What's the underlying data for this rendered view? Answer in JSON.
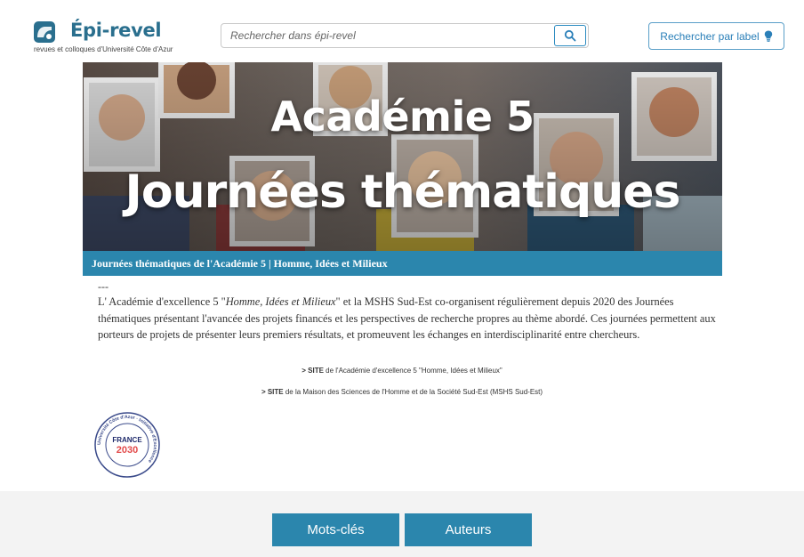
{
  "header": {
    "brand": "Épi-revel",
    "tagline": "revues et colloques d'Université Côte d'Azur",
    "search_placeholder": "Rechercher dans épi-revel",
    "search_icon": "search-icon",
    "label_button": "Rechercher par label",
    "label_icon": "lightbulb-icon",
    "accent_color": "#2a6f8e"
  },
  "banner": {
    "title_line1": "Académie 5",
    "title_line2": "Journées thématiques",
    "caption": "Journées thématiques de l'Académie 5 | Homme, Idées et Milieux",
    "caption_color": "#2b86ad"
  },
  "content": {
    "dashes": "---",
    "intro_before": "L' Académie d'excellence 5 \"",
    "intro_em": "Homme, Idées et Milieux",
    "intro_after": "\" et la MSHS Sud-Est co-organisent régulièrement depuis 2020 des Journées thématiques présentant l'avancée des projets financés et les perspectives de recherche propres au thème abordé. Ces journées permettent aux porteurs de projets de présenter leurs premiers résultats, et promeuvent les échanges en interdisciplinarité entre chercheurs.",
    "link1_prefix": "> SITE",
    "link1_text": " de l'Académie d'excellence 5 \"Homme, Idées et Milieux\"",
    "link2_prefix": "> SITE",
    "link2_text": " de la Maison des Sciences de l'Homme et de la Société Sud-Est (MSHS Sud-Est)"
  },
  "seal": {
    "ring_text": "Université Côte d'Azur · Initiative d'Excellence",
    "center_top": "FRANCE",
    "center_bottom": "2030"
  },
  "footer": {
    "keywords_button": "Mots-clés",
    "authors_button": "Auteurs",
    "button_color": "#2b86ad"
  }
}
